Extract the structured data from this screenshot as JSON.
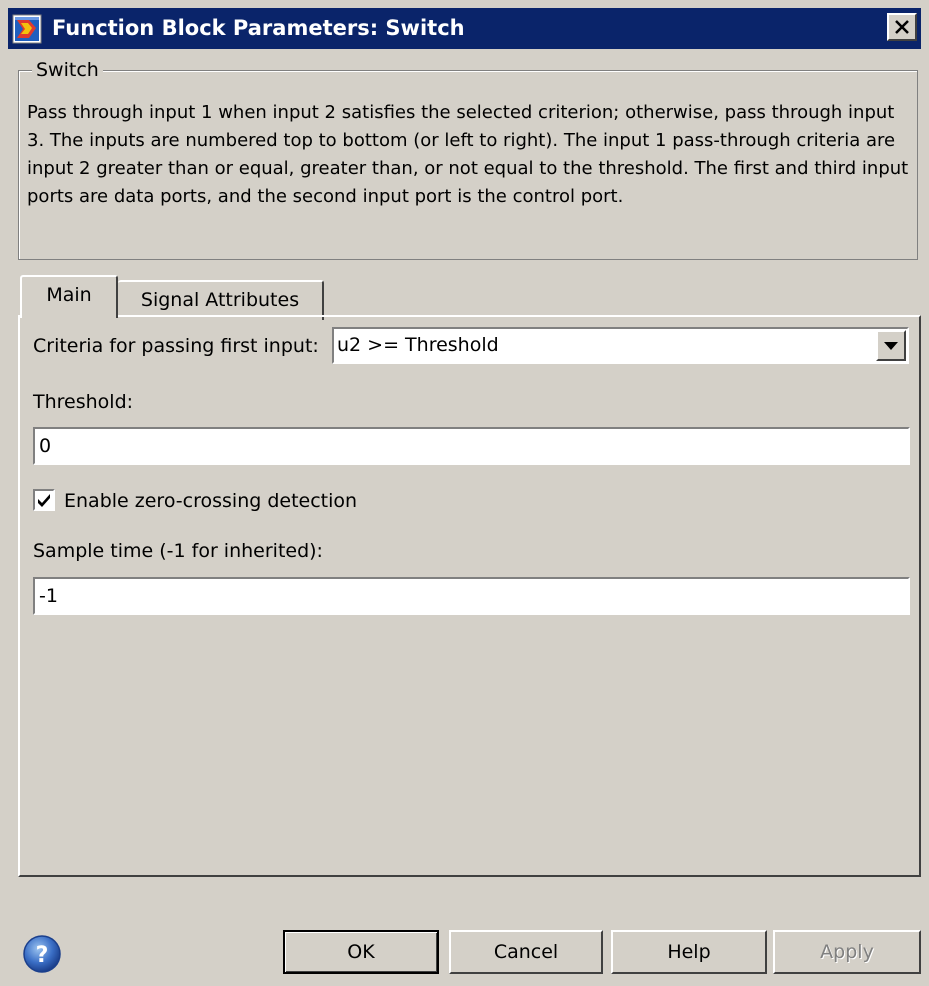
{
  "window": {
    "title": "Function Block Parameters: Switch",
    "close_label": "×"
  },
  "group": {
    "legend": "Switch",
    "description": "Pass through input 1 when input 2 satisfies the selected criterion; otherwise, pass through input 3.  The inputs are numbered top to bottom (or left to right). The input 1 pass-through criteria are input 2 greater than or equal, greater than, or not equal to the threshold.  The first and third input ports are data ports, and the second input port is the control port."
  },
  "tabs": [
    {
      "label": "Main",
      "active": true
    },
    {
      "label": "Signal Attributes",
      "active": false
    }
  ],
  "main": {
    "criteria_label": "Criteria for passing first input:",
    "criteria_value": "u2 >= Threshold",
    "threshold_label": "Threshold:",
    "threshold_value": "0",
    "zero_crossing_label": "Enable zero-crossing detection",
    "zero_crossing_checked": true,
    "sample_time_label": "Sample time (-1 for inherited):",
    "sample_time_value": "-1"
  },
  "buttons": {
    "ok": "OK",
    "cancel": "Cancel",
    "help": "Help",
    "apply": "Apply"
  },
  "colors": {
    "dialog_bg": "#d4d0c8",
    "titlebar": "#0a246a",
    "disabled_text": "#808080"
  },
  "icons": {
    "window": "simulink-block-icon",
    "close": "close-icon",
    "help": "help-question-icon",
    "dropdown": "chevron-down-icon",
    "checkbox": "checkmark-icon"
  }
}
